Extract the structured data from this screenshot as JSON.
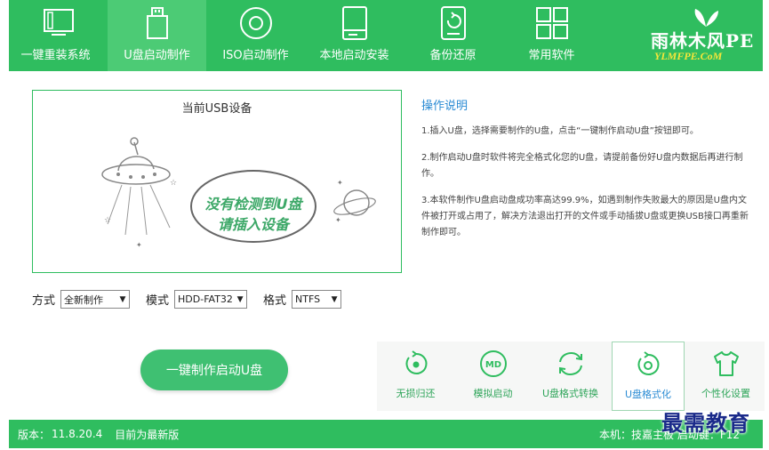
{
  "nav": {
    "items": [
      {
        "label": "一键重装系统",
        "icon": "monitor-icon"
      },
      {
        "label": "U盘启动制作",
        "icon": "usb-drive-icon"
      },
      {
        "label": "ISO启动制作",
        "icon": "disc-icon"
      },
      {
        "label": "本地启动安装",
        "icon": "hard-drive-icon"
      },
      {
        "label": "备份还原",
        "icon": "backup-restore-icon"
      },
      {
        "label": "常用软件",
        "icon": "grid-apps-icon"
      }
    ],
    "active_index": 1
  },
  "brand": {
    "name": "雨林木风PE",
    "url": "YLMFPE.CoM"
  },
  "device": {
    "title": "当前USB设备",
    "empty_line1": "没有检测到U盘",
    "empty_line2": "请插入设备"
  },
  "instructions": {
    "title": "操作说明",
    "step1": "1.插入U盘，选择需要制作的U盘，点击“一键制作启动U盘”按钮即可。",
    "step2": "2.制作启动U盘时软件将完全格式化您的U盘，请提前备份好U盘内数据后再进行制作。",
    "step3": "3.本软件制作U盘启动盘成功率高达99.9%，如遇到制作失败最大的原因是U盘内文件被打开或占用了，解决方法退出打开的文件或手动插拔U盘或更换USB接口再重新制作即可。"
  },
  "options": {
    "mode_label": "方式",
    "mode_value": "全新制作",
    "model_label": "模式",
    "model_value": "HDD-FAT32",
    "format_label": "格式",
    "format_value": "NTFS"
  },
  "make_button": "一键制作启动U盘",
  "tools": [
    {
      "label": "无损归还",
      "icon": "restore-icon"
    },
    {
      "label": "模拟启动",
      "icon": "simulate-boot-icon"
    },
    {
      "label": "U盘格式转换",
      "icon": "convert-icon"
    },
    {
      "label": "U盘格式化",
      "icon": "format-icon"
    },
    {
      "label": "个性化设置",
      "icon": "tshirt-icon"
    }
  ],
  "status": {
    "version_label": "版本：",
    "version": "11.8.20.4",
    "update_status": "目前为最新版",
    "machine": "本机：技嘉主板  启动键：F12"
  },
  "watermark": "最需教育",
  "colors": {
    "primary": "#2fbd5f",
    "link": "#2c8cd4",
    "brand_url": "#f7e63a"
  }
}
